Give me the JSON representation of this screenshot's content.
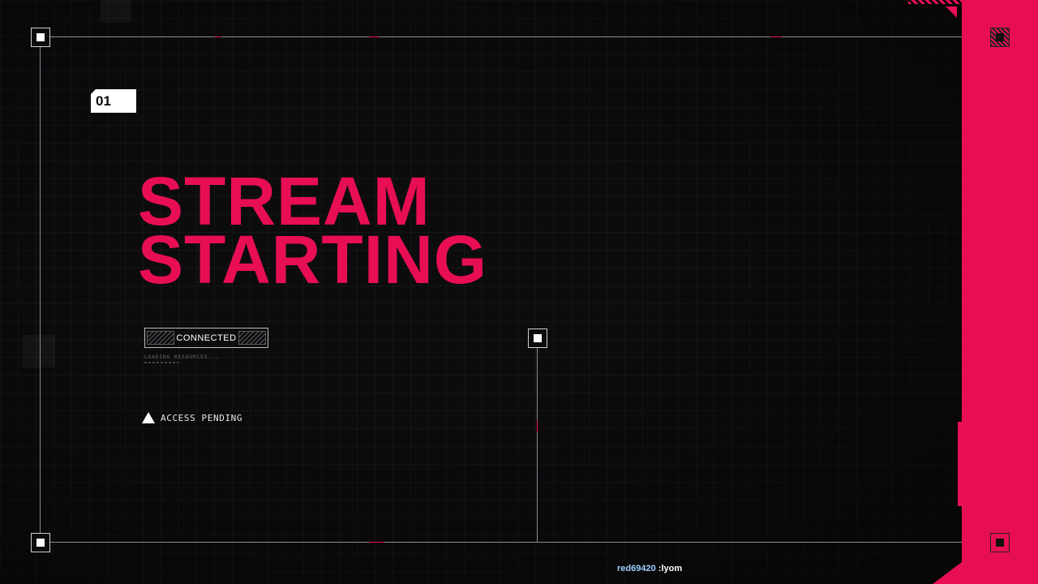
{
  "scene": {
    "badge": "01",
    "headline": [
      "STREAM",
      "STARTING"
    ]
  },
  "status": {
    "connection": "CONNECTED",
    "loading": "LOADING RESOURCES...",
    "access": "ACCESS PENDING"
  },
  "chat": {
    "username": "red69420",
    "message": ":lyom"
  },
  "icons": {
    "access": "warning-triangle-icon"
  },
  "colors": {
    "accent": "#e80e54",
    "background": "#0c0c0e",
    "text": "#ffffff",
    "chat_user": "#9fd0ff"
  }
}
